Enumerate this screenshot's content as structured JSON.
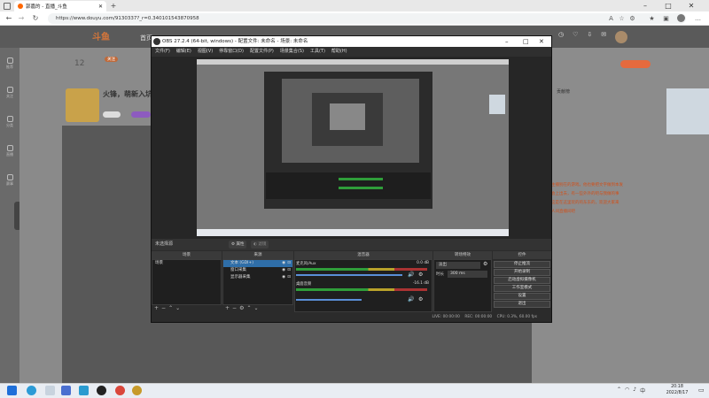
{
  "browser": {
    "tab_title": "郭嘉的 - 直播_斗鱼",
    "url": "https://www.douyu.com/9130337?_r=0.340101543870958",
    "new_tab": "+",
    "icons": [
      "back-icon",
      "forward-icon",
      "refresh-icon",
      "star-icon",
      "extensions-icon",
      "favorites-icon",
      "collections-icon",
      "profile-icon",
      "more-icon"
    ]
  },
  "site": {
    "logo": "斗鱼",
    "nav_first": "首页",
    "sidebar": [
      "推荐",
      "关注",
      "分类",
      "直播",
      "赛事",
      "游戏"
    ],
    "stats": {
      "level": "12",
      "fans_badge": "关注"
    },
    "streamer_title": "火锋，萌新入坑刷",
    "right_tab_active": "贡献榜",
    "right_chat_lines": [
      "主播别在的游戏，他也要把文字做到本发",
      "会上出去，有一些外外的吧与我做的事",
      "这是在这里玩的的东东的，欢迎大家来",
      "人间直播间吧"
    ]
  },
  "obs": {
    "title": "OBS 27.2.4 (64-bit, windows) - 配置文件: 未命名 - 场景: 未命名",
    "menu": [
      "文件(F)",
      "编辑(E)",
      "视图(V)",
      "停靠窗口(D)",
      "配置文件(P)",
      "场景集合(S)",
      "工具(T)",
      "帮助(H)"
    ],
    "toolbar_text": "未选择源",
    "toolbar_buttons": [
      "属性",
      "滤镜"
    ],
    "docks": {
      "scenes_header": "场景",
      "sources_header": "来源",
      "mixer_header": "混音器",
      "transitions_header": "转场特效",
      "controls_header": "控件"
    },
    "scenes": [
      "场景"
    ],
    "sources": [
      "文本 (GDI+)",
      "窗口采集",
      "显示器采集"
    ],
    "mixer": [
      {
        "name": "麦克风/Aux",
        "db": "0.0 dB"
      },
      {
        "name": "桌面音频",
        "db": "-16.1 dB"
      }
    ],
    "transition": {
      "value": "淡出",
      "duration_label": "时长",
      "duration": "300 ms"
    },
    "controls": [
      "停止推流",
      "开始录制",
      "启动虚拟摄像机",
      "工作室模式",
      "设置",
      "退出"
    ],
    "status": {
      "live": "LIVE: 00:00:00",
      "rec": "REC: 00:00:00",
      "cpu": "CPU: 0.3%, 60.00 fps"
    }
  },
  "taskbar": {
    "time": "20:18",
    "date": "2022/8/17",
    "apps": [
      "start-icon",
      "edge-icon",
      "search-icon",
      "store-icon",
      "explorer-icon",
      "obs-icon",
      "settings-icon"
    ]
  }
}
